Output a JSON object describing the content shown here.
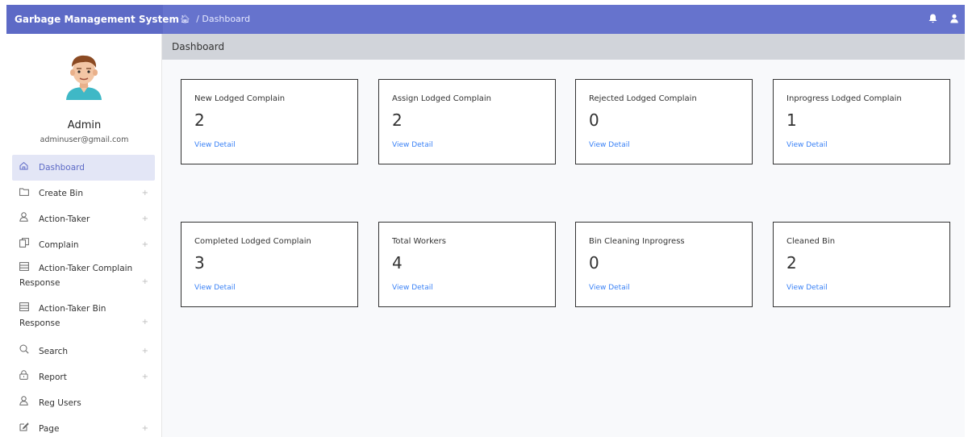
{
  "header": {
    "brand": "Garbage Management System",
    "breadcrumb_home_icon": "home-icon",
    "breadcrumb_sep": "/",
    "breadcrumb": "Dashboard",
    "icons": [
      "bell-icon",
      "user-icon"
    ]
  },
  "sidebar": {
    "avatar_icon": "avatar-icon",
    "name": "Admin",
    "email": "adminuser@gmail.com",
    "items": [
      {
        "label": "Dashboard",
        "icon": "home-icon",
        "active": true,
        "expandable": false
      },
      {
        "label": "Create Bin",
        "icon": "folder-icon",
        "expandable": true
      },
      {
        "label": "Action-Taker",
        "icon": "user-icon",
        "expandable": true
      },
      {
        "label": "Complain",
        "icon": "copy-icon",
        "expandable": true
      },
      {
        "label_line1": "Action-Taker Complain",
        "label_line2": "Response",
        "icon": "list-icon",
        "expandable": true
      },
      {
        "label_line1": "Action-Taker Bin",
        "label_line2": "Response",
        "icon": "list-icon",
        "expandable": true
      },
      {
        "label": "Search",
        "icon": "search-icon",
        "expandable": true
      },
      {
        "label": "Report",
        "icon": "lock-icon",
        "expandable": true
      },
      {
        "label": "Reg Users",
        "icon": "user-icon",
        "expandable": false
      },
      {
        "label": "Page",
        "icon": "edit-icon",
        "expandable": true
      }
    ],
    "plus_symbol": "+"
  },
  "main": {
    "page_title": "Dashboard",
    "cards": [
      {
        "title": "New Lodged Complain",
        "value": "2",
        "link": "View Detail"
      },
      {
        "title": "Assign Lodged Complain",
        "value": "2",
        "link": "View Detail"
      },
      {
        "title": "Rejected Lodged Complain",
        "value": "0",
        "link": "View Detail"
      },
      {
        "title": "Inprogress Lodged Complain",
        "value": "1",
        "link": "View Detail"
      },
      {
        "title": "Completed Lodged Complain",
        "value": "3",
        "link": "View Detail"
      },
      {
        "title": "Total Workers",
        "value": "4",
        "link": "View Detail"
      },
      {
        "title": "Bin Cleaning Inprogress",
        "value": "0",
        "link": "View Detail"
      },
      {
        "title": "Cleaned Bin",
        "value": "2",
        "link": "View Detail"
      }
    ]
  },
  "colors": {
    "topbar": "#6673cd",
    "brand_bg": "#5d6ac6",
    "active_bg": "#e3e6f6",
    "link": "#3b82f6",
    "content_bg": "#f8f9fb"
  }
}
